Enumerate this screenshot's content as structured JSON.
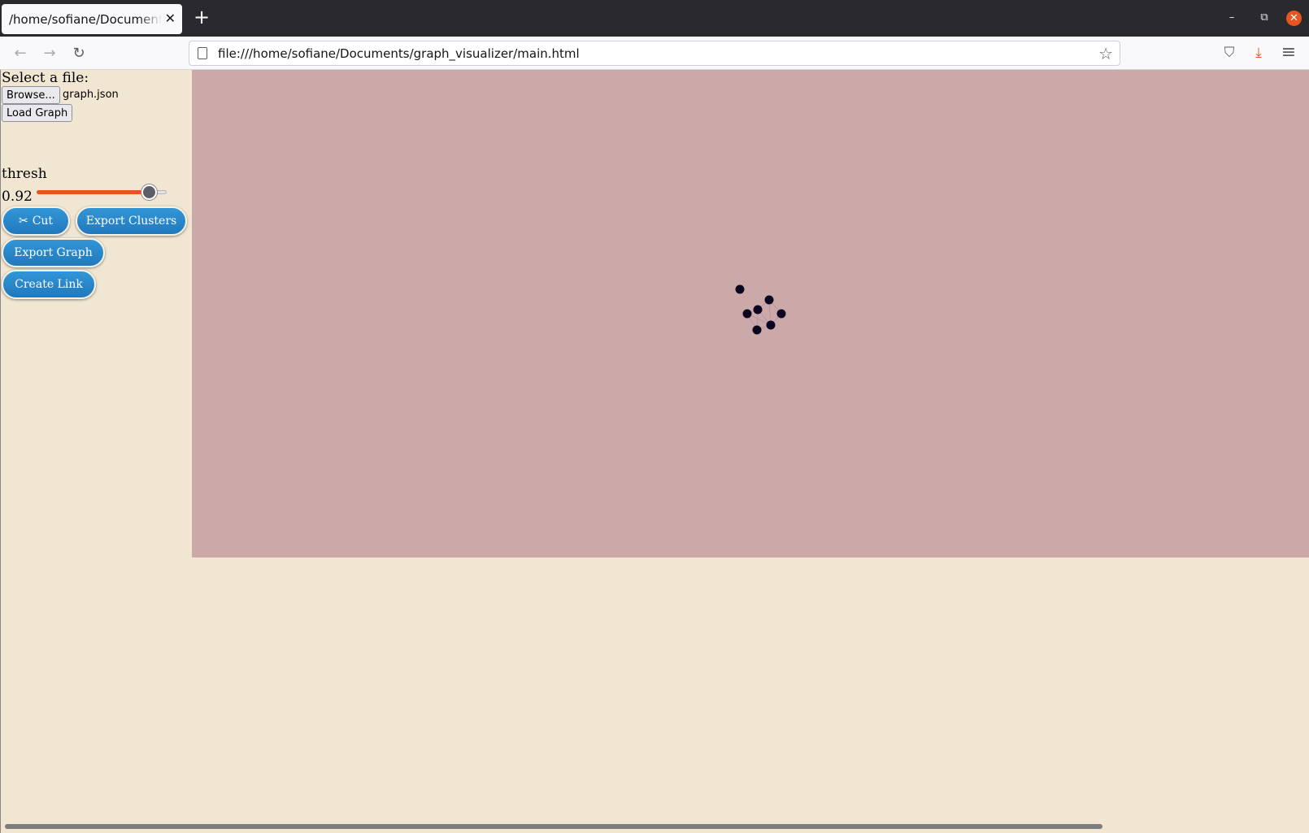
{
  "browser": {
    "tab_title": "/home/sofiane/Documents/graph_visualizer/main.html",
    "tab_close": "✕",
    "new_tab": "+",
    "url": "file:///home/sofiane/Documents/graph_visualizer/main.html",
    "win_minimize": "–",
    "win_restore": "⧉",
    "win_close": "✕",
    "back": "←",
    "forward": "→",
    "reload": "↻",
    "star": "☆",
    "pocket": "⛉",
    "download": "⤓",
    "menu": "≡",
    "accent_color": "#e95420"
  },
  "page": {
    "select_label": "Select a file:",
    "browse_label": "Browse...",
    "file_name": "graph.json",
    "load_label": "Load Graph",
    "thresh_label": "thresh",
    "thresh_value": "0.92",
    "thresh_fraction": 0.87,
    "cut_label": "Cut",
    "cut_icon": "✂",
    "export_clusters_label": "Export Clusters",
    "export_graph_label": "Export Graph",
    "create_link_label": "Create Link",
    "background_color": "#f1e6d2",
    "canvas_color": "#cca9a9",
    "button_color": "#2a88cc"
  },
  "graph": {
    "node_color": "#0c0520",
    "edge_color": "#b896a6",
    "node_count": 8
  }
}
